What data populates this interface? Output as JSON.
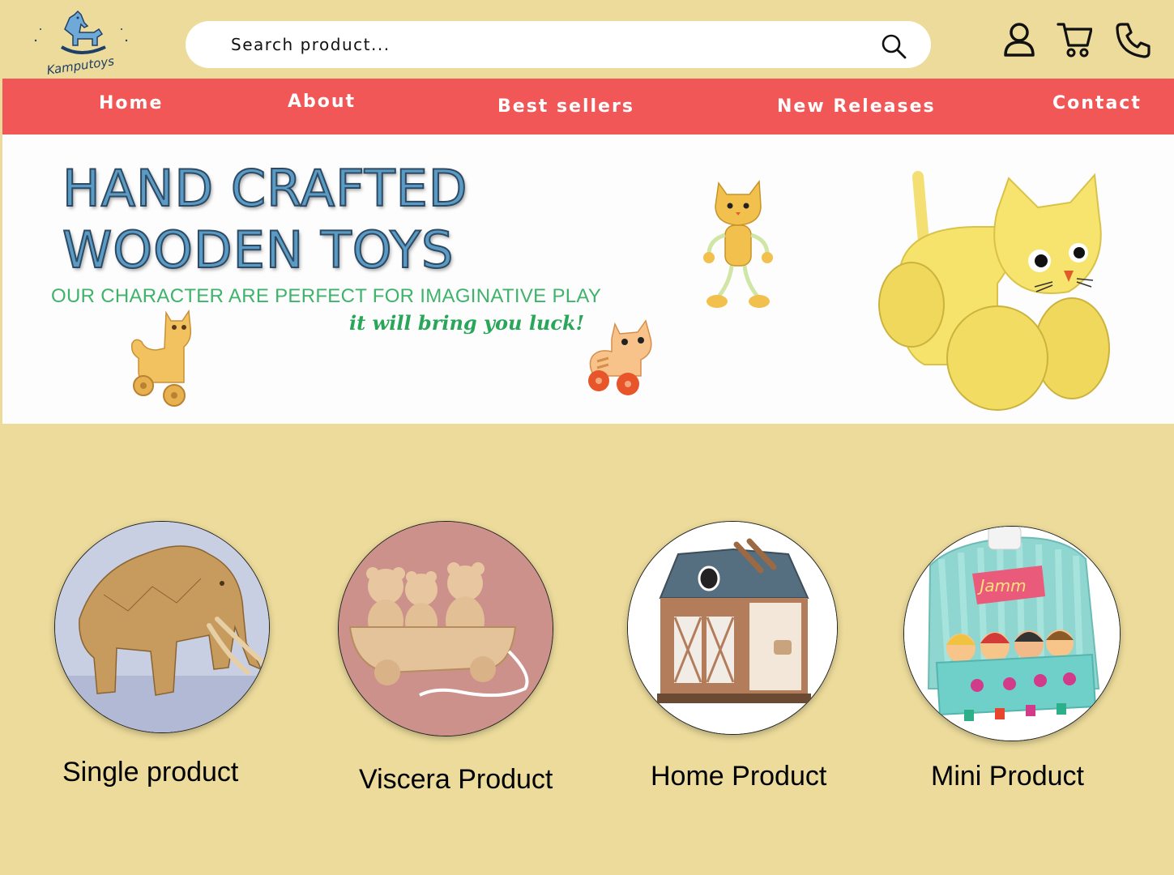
{
  "brand": {
    "name": "Kamputoys",
    "colors": {
      "background": "#ecdb9b",
      "nav": "#f15757",
      "hero_title": "#5a9bc6",
      "hero_sub": "#3eb36a"
    }
  },
  "search": {
    "placeholder": "Search product...",
    "icon": "search-icon"
  },
  "header_icons": [
    "user-icon",
    "cart-icon",
    "phone-icon"
  ],
  "nav": {
    "home": "Home",
    "about": "About",
    "best_sellers": "Best sellers",
    "new_releases": "New Releases",
    "contact": "Contact"
  },
  "hero": {
    "title_line1": "HAND CRAFTED",
    "title_line2": "WOODEN TOYS",
    "subtitle": "OUR CHARACTER ARE PERFECT FOR IMAGINATIVE PLAY",
    "tagline": "it will bring you luck!"
  },
  "categories": {
    "single": "Single product",
    "viscera": "Viscera Product",
    "home": "Home Product",
    "mini": "Mini Product"
  }
}
